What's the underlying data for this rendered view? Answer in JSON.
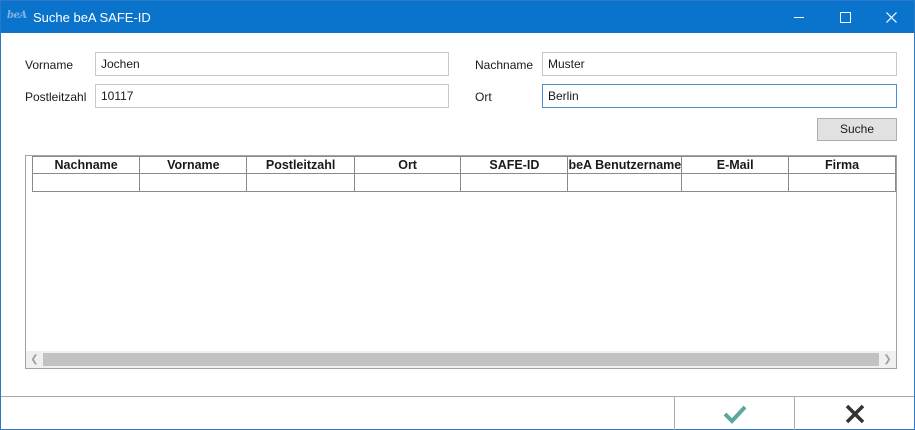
{
  "window": {
    "logo_text": "beA",
    "title": "Suche beA SAFE-ID"
  },
  "form": {
    "vorname_label": "Vorname",
    "vorname_value": "Jochen",
    "nachname_label": "Nachname",
    "nachname_value": "Muster",
    "plz_label": "Postleitzahl",
    "plz_value": "10117",
    "ort_label": "Ort",
    "ort_value": "Berlin",
    "search_button": "Suche"
  },
  "grid": {
    "columns": [
      "Nachname",
      "Vorname",
      "Postleitzahl",
      "Ort",
      "SAFE-ID",
      "beA Benutzername",
      "E-Mail",
      "Firma"
    ]
  },
  "footer": {
    "ok_icon": "checkmark-icon",
    "cancel_icon": "close-x-icon"
  },
  "colors": {
    "titlebar": "#0a74cc",
    "ok": "#5aa89a",
    "cancel": "#333333"
  }
}
